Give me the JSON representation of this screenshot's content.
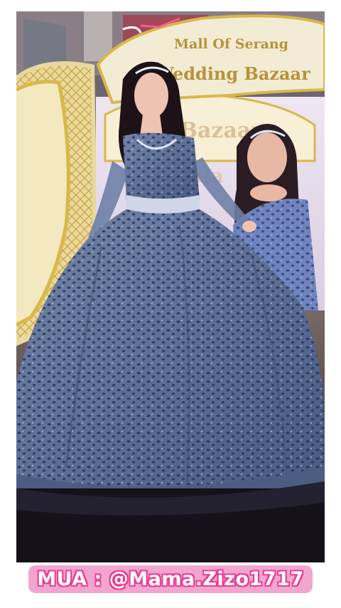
{
  "sign": {
    "line1": "Mall Of Serang",
    "line2": "Wedding Bazaar"
  },
  "screen": {
    "line1": "ing Bazaar",
    "line2": "Ha"
  },
  "caption": {
    "text": "MUA : @Mama.Zizo1717"
  },
  "colors": {
    "gown": "#5d6f96",
    "gold_arch": "#d8b84a",
    "sign_board": "#f3ecd5",
    "caption_bg": "#f2a6cf",
    "caption_stroke": "#ec3b95"
  }
}
